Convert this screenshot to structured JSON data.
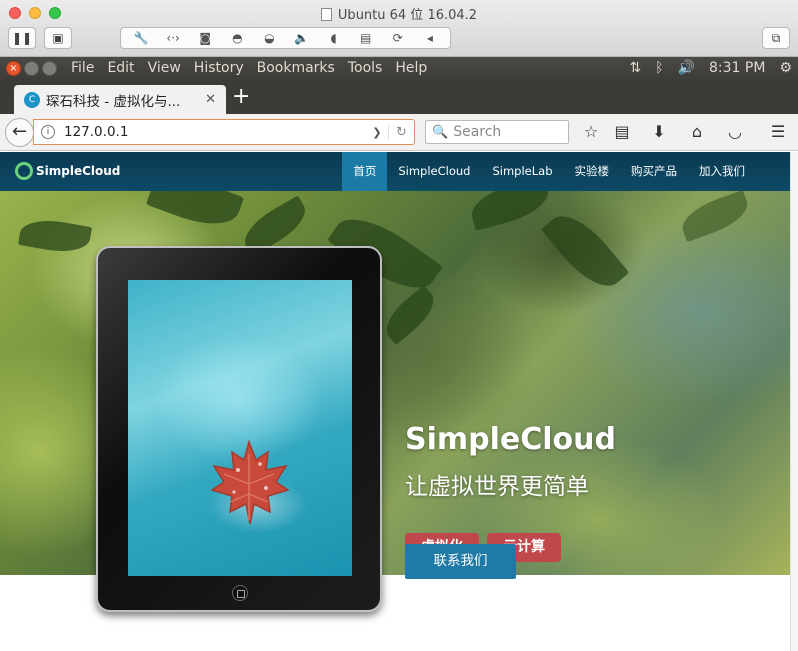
{
  "mac": {
    "window_title": "Ubuntu 64 位 16.04.2"
  },
  "ubuntu": {
    "menu": [
      "File",
      "Edit",
      "View",
      "History",
      "Bookmarks",
      "Tools",
      "Help"
    ],
    "clock": "8:31 PM"
  },
  "browser": {
    "tab_title": "琛石科技 - 虚拟化与...",
    "new_tab": "+",
    "url": "127.0.0.1",
    "search_placeholder": "Search"
  },
  "site": {
    "logo_text": "SimpleCloud",
    "nav": [
      "首页",
      "SimpleCloud",
      "SimpleLab",
      "实验楼",
      "购买产品",
      "加入我们"
    ],
    "nav_active_index": 0,
    "hero_title": "SimpleCloud",
    "hero_tagline": "让虚拟世界更简单",
    "badges": [
      "虚拟化",
      "云计算"
    ],
    "cta": "联系我们",
    "colors": {
      "nav_bg": "#0c4a66",
      "nav_active": "#1c7aa7",
      "badge": "#c0474b",
      "cta": "#1f7aa6"
    }
  },
  "icons": {
    "vm_toolbar": [
      "pause-icon",
      "snapshot-icon",
      "wrench-icon",
      "network-icon",
      "disk-icon",
      "camera-icon",
      "usb-icon",
      "speaker-icon",
      "mouse-icon",
      "save-icon",
      "refresh-icon",
      "collapse-icon",
      "fullscreen-icon"
    ],
    "nav_toolbar": [
      "bookmark-star-icon",
      "reading-list-icon",
      "download-icon",
      "home-icon",
      "pocket-icon",
      "hamburger-menu-icon"
    ]
  }
}
